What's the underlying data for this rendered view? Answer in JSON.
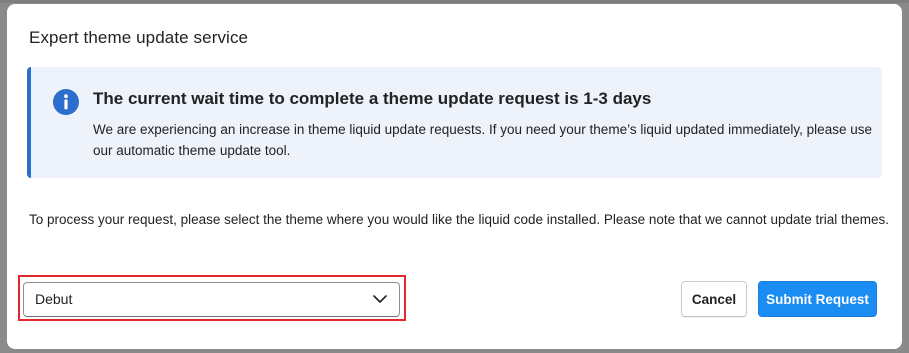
{
  "modal": {
    "title": "Expert theme update service"
  },
  "banner": {
    "icon": "info-icon",
    "accent_color": "#2c6ecb",
    "heading": "The current wait time to complete a theme update request is 1-3 days",
    "body": "We are experiencing an increase in theme liquid update requests. If you need your theme’s liquid updated immediately, please use our automatic theme update tool."
  },
  "instructions": "To process your request, please select the theme where you would like the liquid code installed. Please note that we cannot update trial themes.",
  "theme_select": {
    "selected": "Debut",
    "chevron_icon": "chevron-down-icon"
  },
  "actions": {
    "cancel_label": "Cancel",
    "submit_label": "Submit Request",
    "submit_color": "#1a8cf2"
  },
  "highlight_color": "#e0282e"
}
